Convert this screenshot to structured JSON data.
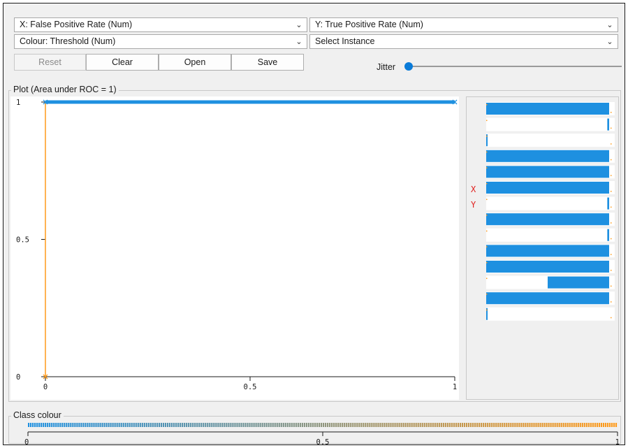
{
  "controls": {
    "x_axis": "X: False Positive Rate (Num)",
    "y_axis": "Y: True Positive Rate (Num)",
    "colour": "Colour: Threshold (Num)",
    "instance": "Select Instance",
    "reset_label": "Reset",
    "clear_label": "Clear",
    "open_label": "Open",
    "save_label": "Save",
    "jitter_label": "Jitter",
    "jitter_value": 0
  },
  "plot": {
    "group_title": "Plot (Area under ROC = 1)",
    "point_colour": "#1e90e0",
    "axis_colour": "#ff9a1a",
    "side_panel": {
      "x_marker": "X",
      "y_marker": "Y",
      "marker_colour": "#e0201e"
    }
  },
  "class_colour": {
    "title": "Class colour",
    "ticks": [
      "0",
      "0.5",
      "1"
    ],
    "start_colour": "#1e90e0",
    "end_colour": "#ff9a1a"
  },
  "chart_data": {
    "type": "line",
    "title": "",
    "xlabel": "",
    "ylabel": "",
    "xlim": [
      0,
      1
    ],
    "ylim": [
      0,
      1
    ],
    "x_ticks": [
      "0",
      "0.5",
      "1"
    ],
    "y_ticks": [
      "0",
      "0.5",
      "1"
    ],
    "grid": false,
    "series": [
      {
        "x": [
          0,
          0,
          1
        ],
        "y": [
          0,
          1,
          1
        ]
      }
    ]
  }
}
